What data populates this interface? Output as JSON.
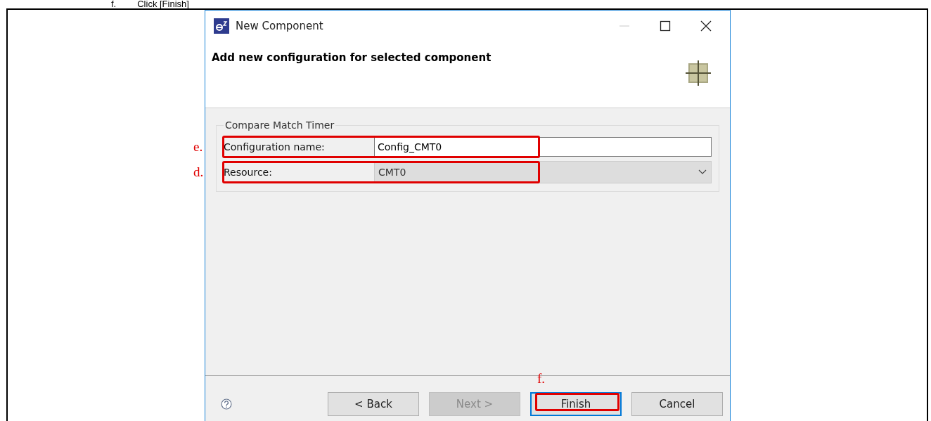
{
  "caption": {
    "step": "f.",
    "text": "Click [Finish]"
  },
  "dialog": {
    "title": "New Component",
    "heading": "Add new configuration for selected component",
    "group": {
      "title": "Compare Match Timer",
      "fields": [
        {
          "kind": "text",
          "label": "Configuration name:",
          "value": "Config_CMT0",
          "disabled": false,
          "annotation": "e."
        },
        {
          "kind": "dropdown",
          "label": "Resource:",
          "value": "CMT0",
          "disabled": true,
          "annotation": "d."
        }
      ]
    },
    "buttons": [
      {
        "label": "< Back",
        "disabled": false,
        "default": false
      },
      {
        "label": "Next >",
        "disabled": true,
        "default": false
      },
      {
        "label": "Finish",
        "disabled": false,
        "default": true,
        "annotation": "f."
      },
      {
        "label": "Cancel",
        "disabled": false,
        "default": false
      }
    ]
  }
}
